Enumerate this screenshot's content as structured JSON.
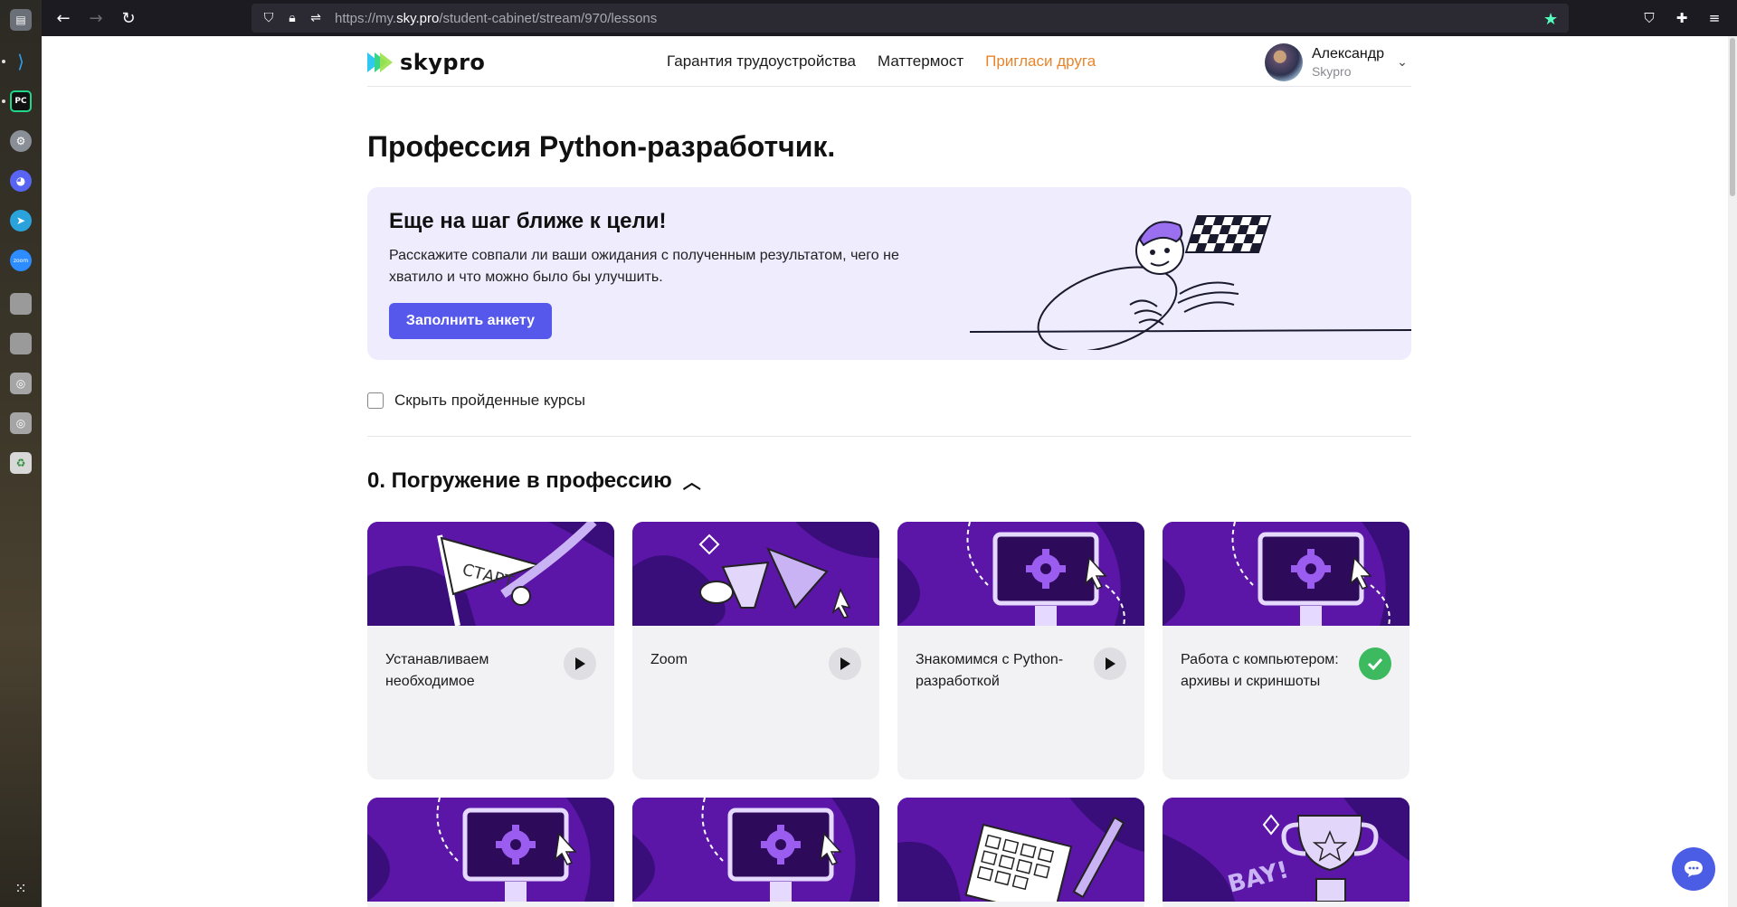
{
  "browser": {
    "url_prefix": "https://my.",
    "url_domain": "sky.pro",
    "url_path": "/student-cabinet/stream/970/lessons"
  },
  "header": {
    "logo_text": "skypro",
    "nav": [
      "Гарантия трудоустройства",
      "Маттермост",
      "Пригласи друга"
    ],
    "user_name": "Александр",
    "user_org": "Skypro"
  },
  "page_title": "Профессия Python-разработчик.",
  "banner": {
    "title": "Еще на шаг ближе к цели!",
    "text": "Расскажите совпали ли ваши ожидания с полученным результатом, чего не хватило и что можно было бы улучшить.",
    "button": "Заполнить анкету"
  },
  "filter": {
    "label": "Скрыть пройденные курсы",
    "checked": false
  },
  "section": {
    "title": "0. Погружение в профессию"
  },
  "cards": [
    {
      "title": "Устанавливаем необходимое",
      "status": "play",
      "image": "start-flag"
    },
    {
      "title": "Zoom",
      "status": "play",
      "image": "zoom-arrows"
    },
    {
      "title": "Знакомимся с Python-разработкой",
      "status": "play",
      "image": "monitor-gear"
    },
    {
      "title": "Работа с компьютером: архивы и скриншоты",
      "status": "done",
      "image": "monitor-gear"
    },
    {
      "title": "",
      "status": "",
      "image": "monitor-gear"
    },
    {
      "title": "",
      "status": "",
      "image": "monitor-gear"
    },
    {
      "title": "",
      "status": "",
      "image": "calendar-pencil"
    },
    {
      "title": "",
      "status": "",
      "image": "trophy"
    }
  ],
  "colors": {
    "accent": "#5558ea",
    "nav_accent": "#e7852c",
    "card_purple": "#5b16a8",
    "done_green": "#3dba5f"
  }
}
